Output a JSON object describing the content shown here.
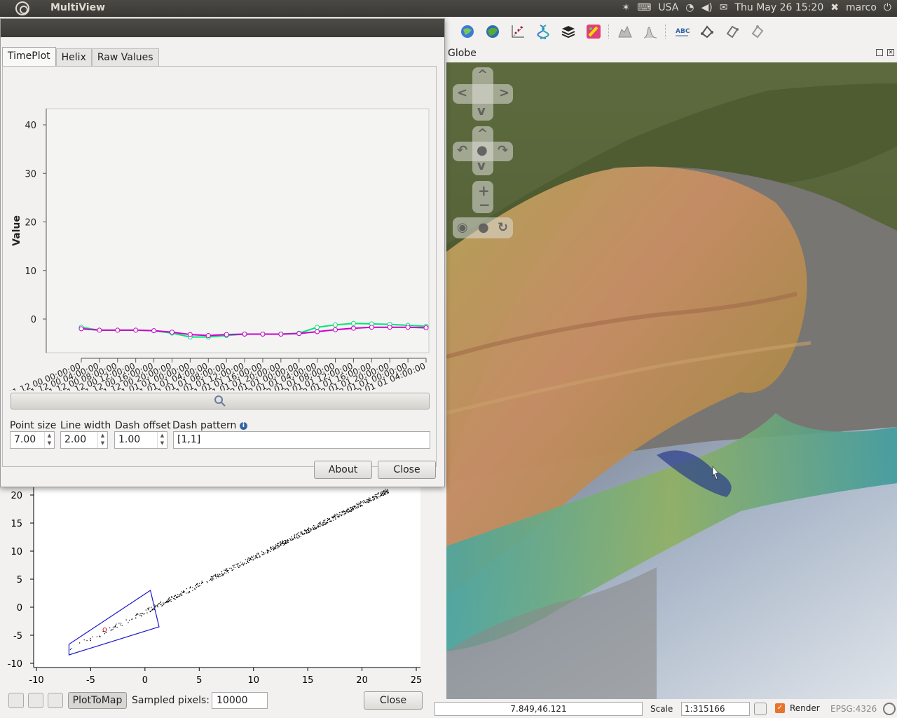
{
  "top_panel": {
    "app_title": "MultiView",
    "keyboard_layout": "USA",
    "datetime": "Thu May 26 15:20",
    "user": "marco"
  },
  "toolbar": {
    "icons": [
      "globe-blue-icon",
      "globe-green-icon",
      "scatter-plot-icon",
      "helix-icon",
      "layers-icon",
      "paint-icon",
      "profile-icon",
      "histogram-icon",
      "label-abc-icon",
      "node-tool-icon",
      "node-tool-2-icon",
      "node-tool-3-icon"
    ]
  },
  "globe_panel": {
    "title": "Globe"
  },
  "dialog": {
    "tabs": [
      {
        "label": "TimePlot",
        "active": true
      },
      {
        "label": "Helix",
        "active": false
      },
      {
        "label": "Raw Values",
        "active": false
      }
    ],
    "options": {
      "point_size_label": "Point size",
      "point_size": "7.00",
      "line_width_label": "Line width",
      "line_width": "2.00",
      "dash_offset_label": "Dash offset",
      "dash_offset": "1.00",
      "dash_pattern_label": "Dash pattern",
      "dash_pattern": "[1,1]"
    },
    "about_label": "About",
    "close_label": "Close"
  },
  "chart_data": [
    {
      "type": "line",
      "ylabel": "Value",
      "ylim": [
        -6,
        43
      ],
      "yticks": [
        0,
        10,
        20,
        30,
        40
      ],
      "grid": false,
      "categories": [
        "31 12 00 00:00:00",
        "31 12 00 04:00:00",
        "31 12 00 08:00:00",
        "31 12 00 12:00:00",
        "31 12 00 16:00:00",
        "31 12 00 20:00:00",
        "01 01 01 00:00:00",
        "01 01 01 04:00:00",
        "01 01 01 08:00:00",
        "01 01 01 12:00:00",
        "01 01 01 16:00:00",
        "01 01 01 20:00:00",
        "02 01 01 00:00:00",
        "02 01 01 04:00:00",
        "02 01 01 08:00:00",
        "02 01 01 12:00:00",
        "02 01 01 16:00:00",
        "02 01 01 20:00:00",
        "03 01 01 00:00:00",
        "03 01 01 04:00:00"
      ],
      "series": [
        {
          "color": "#00e676",
          "values": [
            -1.7,
            -2.3,
            -2.3,
            -2.3,
            -2.4,
            -2.9,
            -3.7,
            -3.7,
            -3.4,
            -3.1,
            -3.1,
            -3.1,
            -2.9,
            -1.7,
            -1.2,
            -0.9,
            -1.0,
            -1.1,
            -1.3,
            -1.5
          ]
        },
        {
          "color": "#cc00cc",
          "values": [
            -2.0,
            -2.3,
            -2.3,
            -2.3,
            -2.4,
            -2.7,
            -3.2,
            -3.4,
            -3.2,
            -3.1,
            -3.1,
            -3.1,
            -3.0,
            -2.6,
            -2.2,
            -1.9,
            -1.7,
            -1.7,
            -1.7,
            -1.8
          ]
        }
      ]
    },
    {
      "type": "scatter",
      "xlim": [
        -10,
        25
      ],
      "ylim": [
        -10,
        21
      ],
      "xticks": [
        -10,
        -5,
        0,
        5,
        10,
        15,
        20,
        25
      ],
      "yticks": [
        -10,
        -5,
        0,
        5,
        10,
        15,
        20
      ],
      "selection_polygon": [
        [
          -7,
          -8.5
        ],
        [
          1.3,
          -3.5
        ],
        [
          0.5,
          3
        ],
        [
          -7,
          -6.6
        ]
      ],
      "trend": {
        "from": [
          -7,
          -7.5
        ],
        "to": [
          22.5,
          21
        ]
      }
    }
  ],
  "scatter_toolbar": {
    "plottomap_label": "PlotToMap",
    "sampled_label": "Sampled pixels:",
    "sampled_value": "10000",
    "close_label": "Close"
  },
  "status_bar": {
    "coordinates": "7.849,46.121",
    "scale_label": "Scale",
    "scale_value": "1:315166",
    "render_label": "Render",
    "epsg": "EPSG:4326"
  }
}
